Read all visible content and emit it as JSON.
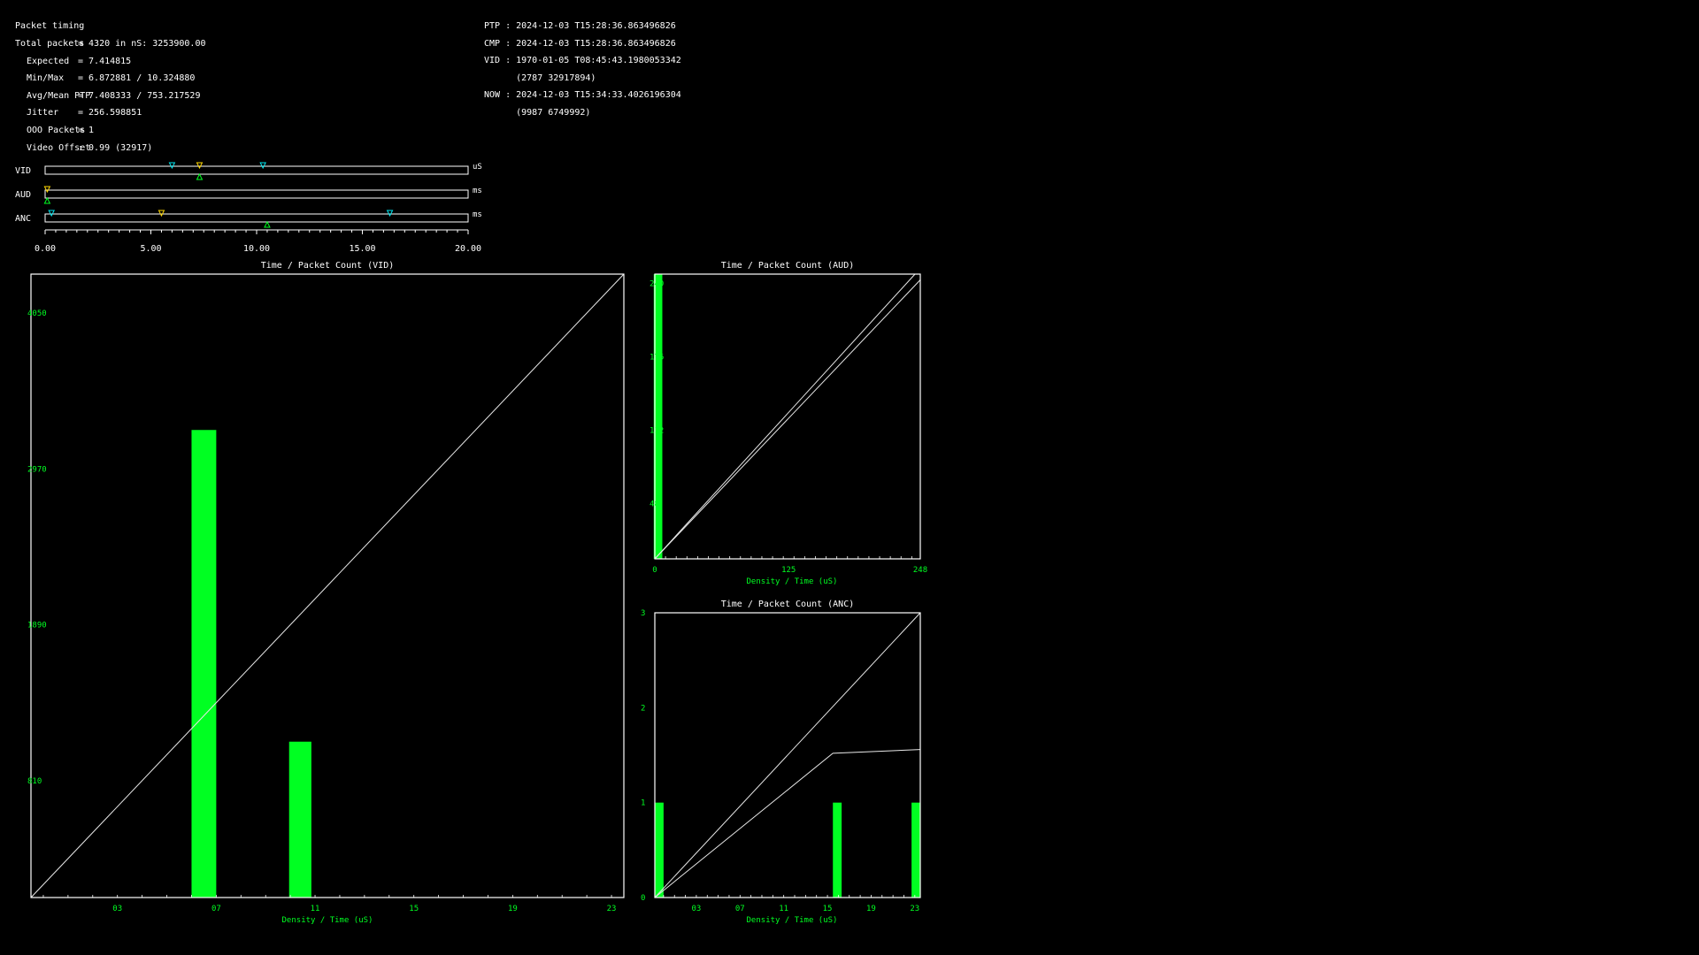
{
  "stats": {
    "title": "Packet timing",
    "rows": [
      {
        "label": "Total packets",
        "value": "= 4320 in nS: 3253900.00"
      },
      {
        "label": "Expected",
        "value": "= 7.414815"
      },
      {
        "label": "Min/Max",
        "value": "= 6.872881 / 10.324880"
      },
      {
        "label": "Avg/Mean PTP",
        "value": "= 7.408333 / 753.217529"
      },
      {
        "label": "Jitter",
        "value": "= 256.598851"
      },
      {
        "label": "OOO Packets",
        "value": "= 1"
      },
      {
        "label": "Video Offset",
        "value": ": 0.99 (32917)"
      }
    ]
  },
  "clocks": [
    "PTP : 2024-12-03 T15:28:36.863496826",
    "CMP : 2024-12-03 T15:28:36.863496826",
    "VID : 1970-01-05 T08:45:43.1980053342",
    "      (2787 32917894)",
    "NOW : 2024-12-03 T15:34:33.4026196304",
    "      (9987 6749992)"
  ],
  "timing_bars": {
    "rows": [
      {
        "name": "VID",
        "unit": "uS",
        "markers": [
          {
            "pos": 6.0,
            "color": "#00e5ee",
            "dir": "down"
          },
          {
            "pos": 7.3,
            "color": "#ffd700",
            "dir": "down"
          },
          {
            "pos": 10.3,
            "color": "#00e5ee",
            "dir": "down"
          },
          {
            "pos": 7.3,
            "color": "#00ff22",
            "dir": "up"
          }
        ]
      },
      {
        "name": "AUD",
        "unit": "ms",
        "markers": [
          {
            "pos": 0.1,
            "color": "#ffd700",
            "dir": "down"
          },
          {
            "pos": 0.1,
            "color": "#00ff22",
            "dir": "up"
          }
        ]
      },
      {
        "name": "ANC",
        "unit": "ms",
        "markers": [
          {
            "pos": 0.3,
            "color": "#00e5ee",
            "dir": "down"
          },
          {
            "pos": 5.5,
            "color": "#ffd700",
            "dir": "down"
          },
          {
            "pos": 16.3,
            "color": "#00e5ee",
            "dir": "down"
          },
          {
            "pos": 10.5,
            "color": "#00ff22",
            "dir": "up"
          }
        ]
      }
    ],
    "axis_min": 0,
    "axis_max": 20,
    "tick_labels": [
      "0.00",
      "5.00",
      "10.00",
      "15.00",
      "20.00"
    ],
    "colors": {
      "cyan": "#00e5ee",
      "yellow": "#ffd700",
      "green": "#00ff22"
    }
  },
  "chart_data": [
    {
      "type": "bar",
      "title": "Time / Packet Count (VID)",
      "xlabel": "Density / Time (uS)",
      "ylabel": "",
      "x_ticks": [
        3,
        7,
        11,
        15,
        19,
        23
      ],
      "x_tick_labels": [
        "03",
        "07",
        "11",
        "15",
        "19",
        "23"
      ],
      "y_ticks": [
        810,
        1890,
        2970,
        4050
      ],
      "y_tick_labels": [
        "810",
        "1890",
        "2970",
        "4050"
      ],
      "xlim": [
        -0.5,
        23.5
      ],
      "ylim": [
        0,
        4320
      ],
      "bars": [
        {
          "x": 6.5,
          "width": 1,
          "value": 3240
        },
        {
          "x": 10.4,
          "width": 0.9,
          "value": 1080
        }
      ],
      "lines": [
        [
          [
            -0.5,
            0
          ],
          [
            23.5,
            4320
          ]
        ]
      ]
    },
    {
      "type": "bar",
      "title": "Time / Packet Count (AUD)",
      "xlabel": "Density / Time (uS)",
      "ylabel": "",
      "x_ticks": [
        0,
        125,
        248
      ],
      "x_tick_labels": [
        "0",
        "125",
        "248"
      ],
      "y_ticks": [
        48,
        112,
        176,
        240
      ],
      "y_tick_labels": [
        "48",
        "112",
        "176",
        "240"
      ],
      "xlim": [
        0,
        248
      ],
      "ylim": [
        0,
        248
      ],
      "bars": [
        {
          "x": 3,
          "width": 8,
          "value": 248
        }
      ],
      "lines": [
        [
          [
            0,
            0
          ],
          [
            243,
            248
          ]
        ],
        [
          [
            0,
            0
          ],
          [
            248,
            243
          ]
        ]
      ]
    },
    {
      "type": "bar",
      "title": "Time / Packet Count (ANC)",
      "xlabel": "Density / Time (uS)",
      "ylabel": "",
      "x_ticks": [
        3,
        7,
        11,
        15,
        19,
        23
      ],
      "x_tick_labels": [
        "03",
        "07",
        "11",
        "15",
        "19",
        "23"
      ],
      "y_ticks": [
        0,
        1,
        2,
        3
      ],
      "y_tick_labels": [
        "0",
        "1",
        "2",
        "3"
      ],
      "xlim": [
        -0.8,
        23.5
      ],
      "ylim": [
        0,
        3
      ],
      "bars": [
        {
          "x": -0.4,
          "width": 0.8,
          "value": 1
        },
        {
          "x": 15.9,
          "width": 0.8,
          "value": 1
        },
        {
          "x": 23.1,
          "width": 0.8,
          "value": 1
        }
      ],
      "lines": [
        [
          [
            -0.8,
            0
          ],
          [
            23.5,
            3
          ]
        ],
        [
          [
            -0.8,
            0
          ],
          [
            15.5,
            1.52
          ],
          [
            23.5,
            1.56
          ]
        ]
      ]
    }
  ]
}
